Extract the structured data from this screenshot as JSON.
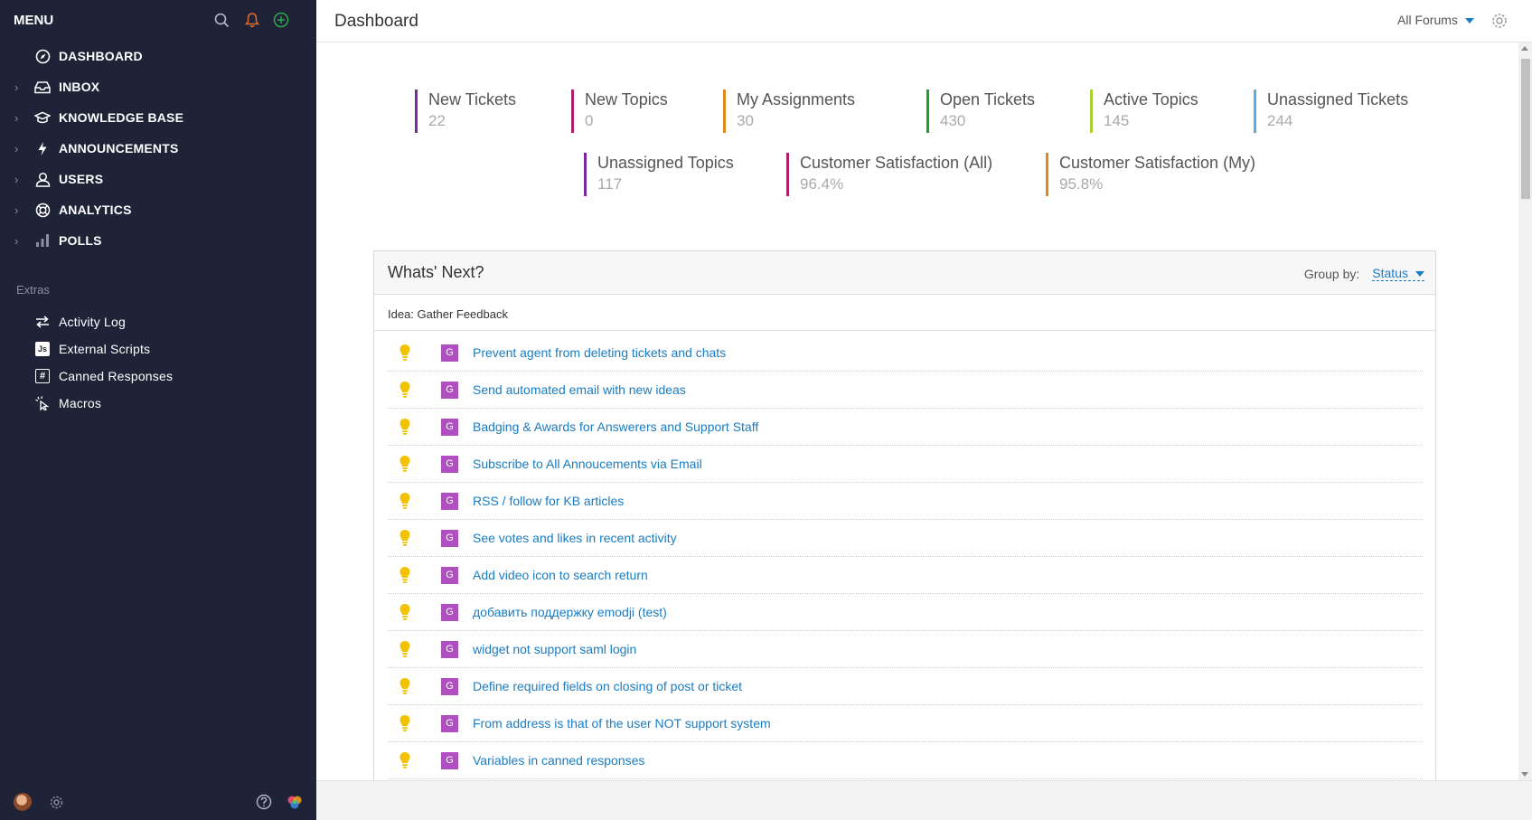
{
  "sidebar": {
    "menu_title": "MENU",
    "nav": [
      {
        "label": "DASHBOARD",
        "icon": "compass-icon",
        "has_chevron": false
      },
      {
        "label": "INBOX",
        "icon": "inbox-icon",
        "has_chevron": true
      },
      {
        "label": "KNOWLEDGE BASE",
        "icon": "graduation-cap-icon",
        "has_chevron": true
      },
      {
        "label": "ANNOUNCEMENTS",
        "icon": "bolt-icon",
        "has_chevron": true
      },
      {
        "label": "USERS",
        "icon": "user-icon",
        "has_chevron": true
      },
      {
        "label": "ANALYTICS",
        "icon": "lifebuoy-icon",
        "has_chevron": true
      },
      {
        "label": "POLLS",
        "icon": "bar-chart-icon",
        "has_chevron": true
      }
    ],
    "extras_title": "Extras",
    "extras": [
      {
        "label": "Activity Log",
        "icon": "arrows-exchange-icon"
      },
      {
        "label": "External Scripts",
        "icon": "js-icon"
      },
      {
        "label": "Canned Responses",
        "icon": "hash-icon"
      },
      {
        "label": "Macros",
        "icon": "cursor-click-icon"
      }
    ],
    "js_glyph": "Js",
    "hash_glyph": "#"
  },
  "topbar": {
    "page_title": "Dashboard",
    "forum_select": "All Forums"
  },
  "stats": [
    {
      "label": "New Tickets",
      "value": "22",
      "color": "#7b2a9e"
    },
    {
      "label": "New Topics",
      "value": "0",
      "color": "#b0206a"
    },
    {
      "label": "My Assignments",
      "value": "30",
      "color": "#e08a1e"
    },
    {
      "label": "Open Tickets",
      "value": "430",
      "color": "#1e9e2a"
    },
    {
      "label": "Active Topics",
      "value": "145",
      "color": "#a8d032"
    },
    {
      "label": "Unassigned Tickets",
      "value": "244",
      "color": "#5aaee8"
    },
    {
      "label": "Unassigned Topics",
      "value": "117",
      "color": "#7b2a9e"
    },
    {
      "label": "Customer Satisfaction (All)",
      "value": "96.4%",
      "color": "#b0206a"
    },
    {
      "label": "Customer Satisfaction (My)",
      "value": "95.8%",
      "color": "#e08a1e"
    }
  ],
  "whats_next": {
    "title": "Whats' Next?",
    "group_by_label": "Group by:",
    "group_by_value": "Status",
    "section_label": "Idea: Gather Feedback",
    "badge": "G",
    "colors": {
      "bulb": "#f2c200",
      "badge": "#b04fc0",
      "link": "#1a7cc2"
    },
    "items": [
      "Prevent agent from deleting tickets and chats",
      "Send automated email with new ideas",
      "Badging & Awards for Answerers and Support Staff",
      "Subscribe to All Annoucements via Email",
      "RSS / follow for KB articles",
      "See votes and likes in recent activity",
      "Add video icon to search return",
      "добавить поддержку emodji (test)",
      "widget not support saml login",
      "Define required fields on closing of post or ticket",
      "From address is that of the user NOT support system",
      "Variables in canned responses"
    ]
  }
}
